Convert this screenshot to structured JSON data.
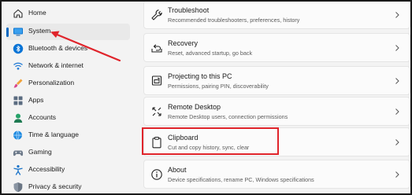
{
  "sidebar": {
    "items": [
      {
        "label": "Home",
        "icon": "home-icon"
      },
      {
        "label": "System",
        "icon": "monitor-icon",
        "selected": true
      },
      {
        "label": "Bluetooth & devices",
        "icon": "bluetooth-icon"
      },
      {
        "label": "Network & internet",
        "icon": "network-icon"
      },
      {
        "label": "Personalization",
        "icon": "brush-icon"
      },
      {
        "label": "Apps",
        "icon": "apps-icon"
      },
      {
        "label": "Accounts",
        "icon": "person-icon"
      },
      {
        "label": "Time & language",
        "icon": "globe-clock-icon"
      },
      {
        "label": "Gaming",
        "icon": "gamepad-icon"
      },
      {
        "label": "Accessibility",
        "icon": "accessibility-icon"
      },
      {
        "label": "Privacy & security",
        "icon": "shield-icon"
      }
    ]
  },
  "cards": [
    {
      "title": "Troubleshoot",
      "description": "Recommended troubleshooters, preferences, history",
      "icon": "wrench-icon"
    },
    {
      "title": "Recovery",
      "description": "Reset, advanced startup, go back",
      "icon": "recovery-icon"
    },
    {
      "title": "Projecting to this PC",
      "description": "Permissions, pairing PIN, discoverability",
      "icon": "projector-icon"
    },
    {
      "title": "Remote Desktop",
      "description": "Remote Desktop users, connection permissions",
      "icon": "remote-desktop-icon"
    },
    {
      "title": "Clipboard",
      "description": "Cut and copy history, sync, clear",
      "icon": "clipboard-icon"
    },
    {
      "title": "About",
      "description": "Device specifications, rename PC, Windows specifications",
      "icon": "info-icon"
    }
  ],
  "colors": {
    "accent": "#0067c0",
    "annotation_red": "#e0242b"
  }
}
